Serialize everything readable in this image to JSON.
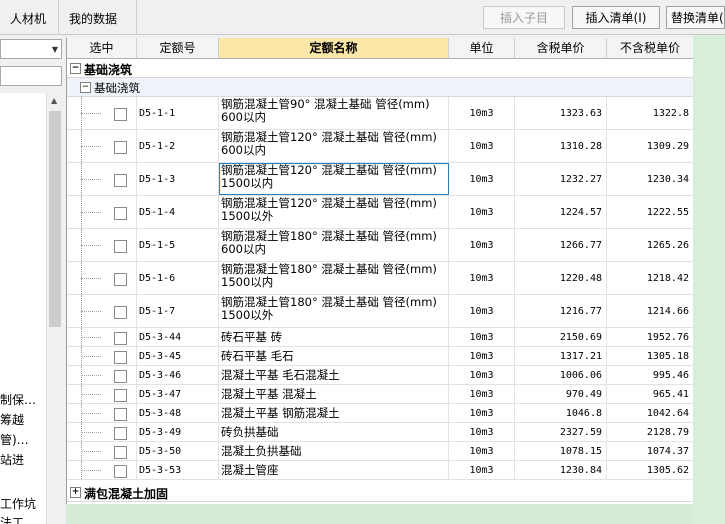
{
  "tabs": [
    "人材机",
    "我的数据"
  ],
  "toolbar": {
    "insert_child": "插入子目",
    "insert_list": "插入清单(I)",
    "replace_list": "替换清单(R)"
  },
  "left_panel": {
    "items": [
      "制保…",
      "筹越",
      "管)…",
      "站进",
      "工作坑",
      "法工…"
    ]
  },
  "columns": {
    "select": "选中",
    "code": "定额号",
    "name": "定额名称",
    "unit": "单位",
    "tax_price": "含税单价",
    "notax_price": "不含税单价"
  },
  "groups": {
    "g1": "基础浇筑",
    "g1_sub": "基础浇筑",
    "g2": "满包混凝土加固"
  },
  "rows": [
    {
      "code": "D5-1-1",
      "name1": "钢筋混凝土管90° 混凝土基础 管径(mm)",
      "name2": "600以内",
      "unit": "10m3",
      "tax": "1323.63",
      "notax": "1322.8"
    },
    {
      "code": "D5-1-2",
      "name1": "钢筋混凝土管120° 混凝土基础 管径(mm)",
      "name2": "600以内",
      "unit": "10m3",
      "tax": "1310.28",
      "notax": "1309.29"
    },
    {
      "code": "D5-1-3",
      "name1": "钢筋混凝土管120° 混凝土基础 管径(mm)",
      "name2": "1500以内",
      "unit": "10m3",
      "tax": "1232.27",
      "notax": "1230.34"
    },
    {
      "code": "D5-1-4",
      "name1": "钢筋混凝土管120° 混凝土基础 管径(mm)",
      "name2": "1500以外",
      "unit": "10m3",
      "tax": "1224.57",
      "notax": "1222.55"
    },
    {
      "code": "D5-1-5",
      "name1": "钢筋混凝土管180° 混凝土基础 管径(mm)",
      "name2": "600以内",
      "unit": "10m3",
      "tax": "1266.77",
      "notax": "1265.26"
    },
    {
      "code": "D5-1-6",
      "name1": "钢筋混凝土管180° 混凝土基础 管径(mm)",
      "name2": "1500以内",
      "unit": "10m3",
      "tax": "1220.48",
      "notax": "1218.42"
    },
    {
      "code": "D5-1-7",
      "name1": "钢筋混凝土管180° 混凝土基础 管径(mm)",
      "name2": "1500以外",
      "unit": "10m3",
      "tax": "1216.77",
      "notax": "1214.66"
    },
    {
      "code": "D5-3-44",
      "name1": "砖石平基 砖",
      "name2": "",
      "unit": "10m3",
      "tax": "2150.69",
      "notax": "1952.76"
    },
    {
      "code": "D5-3-45",
      "name1": "砖石平基 毛石",
      "name2": "",
      "unit": "10m3",
      "tax": "1317.21",
      "notax": "1305.18"
    },
    {
      "code": "D5-3-46",
      "name1": "混凝土平基 毛石混凝土",
      "name2": "",
      "unit": "10m3",
      "tax": "1006.06",
      "notax": "995.46"
    },
    {
      "code": "D5-3-47",
      "name1": "混凝土平基 混凝土",
      "name2": "",
      "unit": "10m3",
      "tax": "970.49",
      "notax": "965.41"
    },
    {
      "code": "D5-3-48",
      "name1": "混凝土平基 钢筋混凝土",
      "name2": "",
      "unit": "10m3",
      "tax": "1046.8",
      "notax": "1042.64"
    },
    {
      "code": "D5-3-49",
      "name1": "砖负拱基础",
      "name2": "",
      "unit": "10m3",
      "tax": "2327.59",
      "notax": "2128.79"
    },
    {
      "code": "D5-3-50",
      "name1": "混凝土负拱基础",
      "name2": "",
      "unit": "10m3",
      "tax": "1078.15",
      "notax": "1074.37"
    },
    {
      "code": "D5-3-53",
      "name1": "混凝土管座",
      "name2": "",
      "unit": "10m3",
      "tax": "1230.84",
      "notax": "1305.62"
    }
  ]
}
